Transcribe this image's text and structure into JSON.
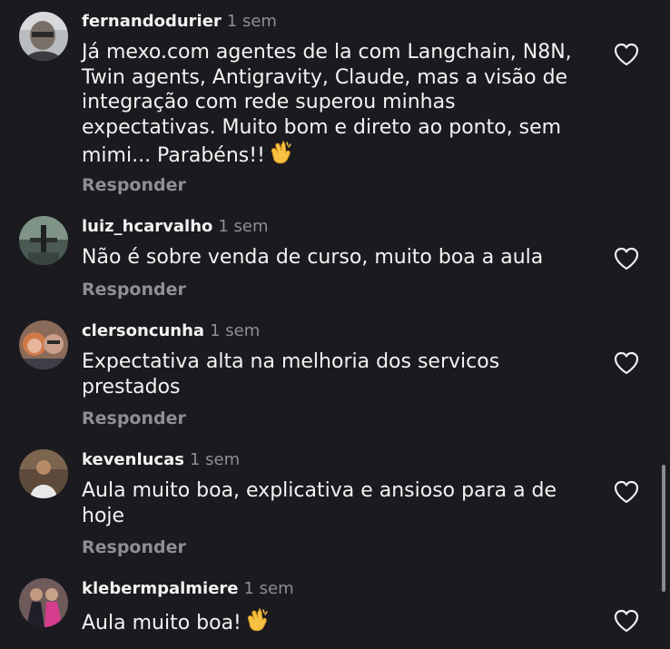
{
  "reply_label": "Responder",
  "comments": [
    {
      "username": "fernandodurier",
      "time": "1 sem",
      "text": "Já mexo.com agentes de la com Langchain, N8N,\nTwin agents, Antigravity, Claude, mas a visão de\nintegração com rede superou minhas\nexpectativas. Muito bom e direto ao ponto, sem\nmimi... Parabéns!!",
      "emoji": "clapping-hands"
    },
    {
      "username": "luiz_hcarvalho",
      "time": "1 sem",
      "text": "Não é sobre venda de curso, muito boa a aula"
    },
    {
      "username": "clersoncunha",
      "time": "1 sem",
      "text": "Expectativa alta na melhoria dos servicos\nprestados"
    },
    {
      "username": "kevenlucas",
      "time": "1 sem",
      "text": "Aula muito boa, explicativa e ansioso para a de\nhoje"
    },
    {
      "username": "klebermpalmiere",
      "time": "1 sem",
      "text": "Aula muito boa!",
      "emoji": "clapping-hands"
    }
  ],
  "colors": {
    "background": "#1a1a1f",
    "text": "#f3f3f3",
    "muted": "#8e8e93"
  }
}
